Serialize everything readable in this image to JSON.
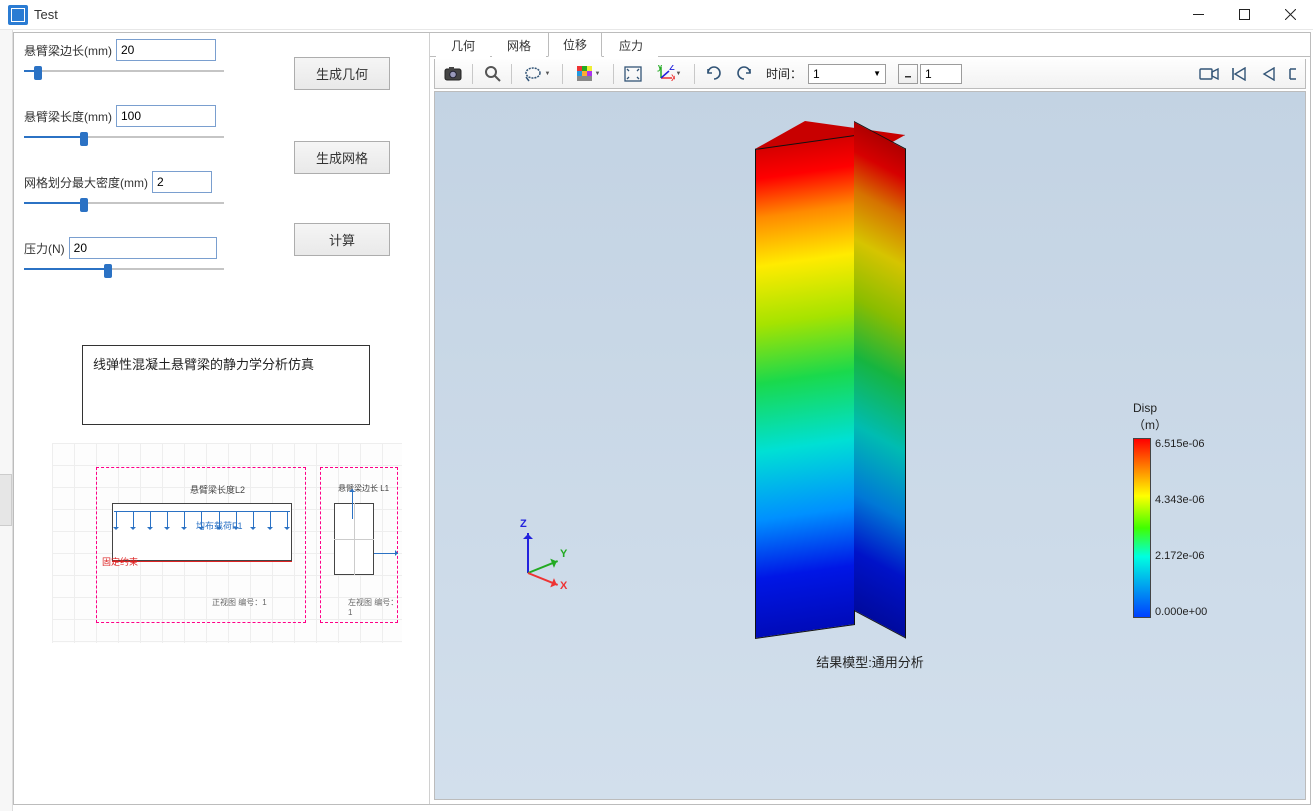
{
  "window": {
    "title": "Test"
  },
  "sidebar": {
    "params": {
      "edge_length": {
        "label": "悬臂梁边长(mm)",
        "value": "20",
        "slider_pct": 5
      },
      "beam_length": {
        "label": "悬臂梁长度(mm)",
        "value": "100",
        "slider_pct": 28
      },
      "mesh_density": {
        "label": "网格划分最大密度(mm)",
        "value": "2",
        "slider_pct": 28
      },
      "pressure": {
        "label": "压力(N)",
        "value": "20",
        "slider_pct": 40
      }
    },
    "buttons": {
      "gen_geometry": "生成几何",
      "gen_mesh": "生成网格",
      "compute": "计算"
    },
    "description": "线弹性混凝土悬臂梁的静力学分析仿真",
    "diagram": {
      "span_label": "悬臂梁长度L2",
      "load_label": "均布载荷F1",
      "fix_label": "固定约束",
      "view1": "正视图\n编号：1",
      "cross_label": "悬臂梁边长 L1",
      "view2": "左视图\n编号：1"
    }
  },
  "tabs": [
    {
      "label": "几何",
      "active": false
    },
    {
      "label": "网格",
      "active": false
    },
    {
      "label": "位移",
      "active": true
    },
    {
      "label": "应力",
      "active": false
    }
  ],
  "toolbar": {
    "time_label": "时间：",
    "time_value": "1",
    "step_value": "1"
  },
  "viewport": {
    "triad": {
      "x": "X",
      "y": "Y",
      "z": "Z"
    },
    "caption": "结果模型:通用分析",
    "legend": {
      "title_line1": "Disp",
      "title_line2": "（m）",
      "ticks": [
        "6.515e-06",
        "4.343e-06",
        "2.172e-06",
        "0.000e+00"
      ]
    }
  },
  "chart_data": {
    "type": "heatmap",
    "title": "Disp (m)",
    "field": "displacement_magnitude",
    "units": "m",
    "colormap": "rainbow",
    "range": [
      0.0,
      6.515e-06
    ],
    "ticks": [
      0.0,
      2.172e-06,
      4.343e-06,
      6.515e-06
    ],
    "geometry": "vertical rectangular cantilever beam",
    "gradient_direction": "bottom (fixed, 0) to top (free, max)"
  }
}
